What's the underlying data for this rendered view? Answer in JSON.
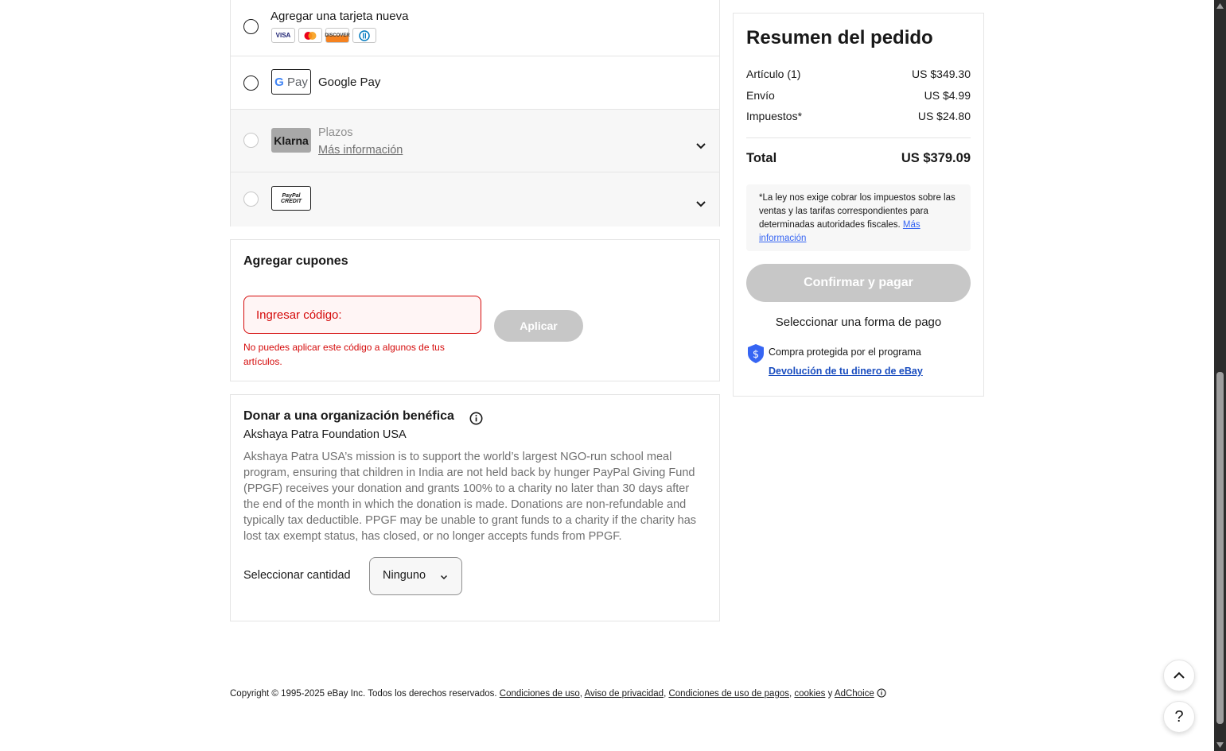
{
  "payment": {
    "new_card_label": "Agregar una tarjeta nueva",
    "card_logos": [
      "VISA",
      "mastercard",
      "DISCOVER",
      "diners"
    ],
    "gpay_logo": "G Pay",
    "gpay_label": "Google Pay",
    "klarna_logo": "Klarna",
    "klarna_label": "Plazos",
    "klarna_link": "Más información",
    "paypal_credit_logo": "PayPal CREDIT"
  },
  "coupons": {
    "title": "Agregar cupones",
    "input_placeholder": "Ingresar código:",
    "apply_label": "Aplicar",
    "error": "No puedes aplicar este código a algunos de tus artículos."
  },
  "donation": {
    "title": "Donar a una organización benéfica",
    "org": "Akshaya Patra Foundation USA",
    "description": "Akshaya Patra USA’s mission is to support the world’s largest NGO-run school meal program, ensuring that children in India are not held back by hunger PayPal Giving Fund (PPGF) receives your donation and grants 100% to a charity no later than 30 days after the end of the month in which the donation is made. Donations are non-refundable and typically tax deductible. PPGF may be unable to grant funds to a charity if the charity has lost tax exempt status, has closed, or no longer accepts funds from PPGF.",
    "select_label": "Seleccionar cantidad",
    "select_value": "Ninguno"
  },
  "summary": {
    "title": "Resumen del pedido",
    "rows": [
      {
        "label": "Artículo (1)",
        "value": "US $349.30"
      },
      {
        "label": "Envío",
        "value": "US $4.99"
      },
      {
        "label": "Impuestos*",
        "value": "US $24.80"
      }
    ],
    "total_label": "Total",
    "total_value": "US $379.09",
    "tax_note": "*La ley nos exige cobrar los impuestos sobre las ventas y las tarifas correspondientes para determinadas autoridades fiscales.",
    "tax_link": "Más información",
    "confirm_label": "Confirmar y pagar",
    "select_payment": "Seleccionar una forma de pago",
    "protect_text": "Compra protegida por el programa",
    "protect_link": "Devolución de tu dinero de eBay"
  },
  "footer": {
    "copyright": "Copyright © 1995-2025 eBay Inc. Todos los derechos reservados.",
    "link_terms": "Condiciones de uso",
    "link_privacy": "Aviso de privacidad",
    "link_payments": "Condiciones de uso de pagos",
    "link_cookies": "cookies",
    "conj": "y",
    "link_adchoice": "AdChoice"
  },
  "floating": {
    "help_label": "?"
  },
  "colors": {
    "error": "#d50b0b",
    "link": "#3665f3",
    "disabled_button": "#c7c7c7",
    "protect_shield": "#3665f3"
  }
}
